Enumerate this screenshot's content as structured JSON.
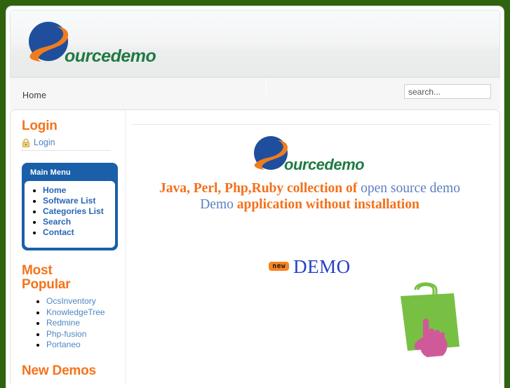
{
  "theme": {
    "page_background": "#2f6310",
    "accent_orange": "#f5731a",
    "link_blue": "#4e86c4",
    "menu_blue": "#1a5fa9",
    "logo_green": "#1f7a43",
    "logo_blue": "#1f4f9c",
    "logo_orange": "#f07c1e",
    "bag_green": "#77c043",
    "hand_pink": "#d0599a"
  },
  "header": {
    "logo": {
      "icon_name": "sourcedemo-swoosh-logo",
      "wordmark": "ourcedemo"
    }
  },
  "nav": {
    "breadcrumb": "Home",
    "search": {
      "placeholder": "search...",
      "value": "",
      "icon_name": "search-input"
    }
  },
  "sidebar": {
    "login_module": {
      "heading": "Login",
      "lock_icon": "padlock-icon",
      "link_label": "Login"
    },
    "main_menu": {
      "title": "Main Menu",
      "items": [
        {
          "label": "Home"
        },
        {
          "label": "Software List"
        },
        {
          "label": "Categories List"
        },
        {
          "label": "Search"
        },
        {
          "label": "Contact"
        }
      ]
    },
    "most_popular": {
      "heading": "Most Popular",
      "items": [
        {
          "label": "OcsInventory"
        },
        {
          "label": "KnowledgeTree"
        },
        {
          "label": "Redmine"
        },
        {
          "label": "Php-fusion"
        },
        {
          "label": "Portaneo"
        }
      ]
    },
    "new_demos": {
      "heading": "New Demos"
    }
  },
  "main": {
    "hero_logo": {
      "icon_name": "sourcedemo-swoosh-logo",
      "wordmark": "ourcedemo"
    },
    "tagline": {
      "line1_part1": "Java, Perl, Php,Ruby collection of ",
      "line1_part2": "open source demo",
      "line2_part1": "Demo ",
      "line2_part2": "application without installation"
    },
    "demo_badge": {
      "new_label": "new",
      "demo_label": "DEMO"
    },
    "bag_graphic": {
      "icon_name": "shopping-bag-with-pointing-hand-icon"
    }
  }
}
